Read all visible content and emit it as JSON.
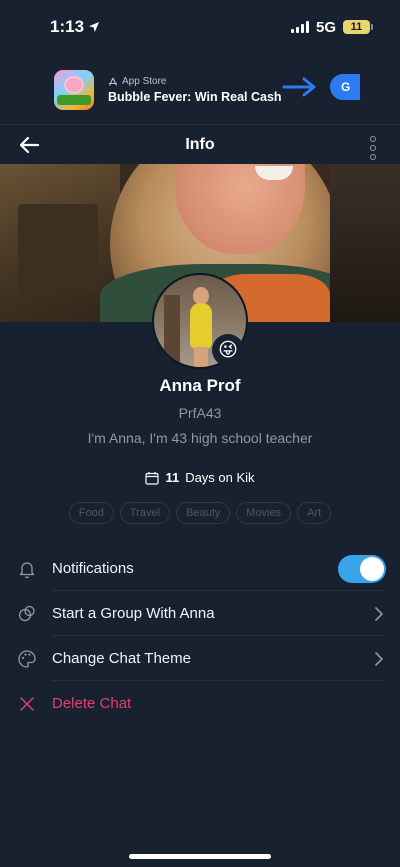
{
  "status_bar": {
    "time": "1:13",
    "network": "5G",
    "battery": "11"
  },
  "ad": {
    "source": "App Store",
    "title": "Bubble Fever: Win Real Cash",
    "button": "G",
    "arrow_color": "#2a7cf0"
  },
  "header": {
    "title": "Info"
  },
  "profile": {
    "name": "Anna Prof",
    "username": "PrfA43",
    "bio": "I'm Anna, I'm 43 high school teacher",
    "days_count": "11",
    "days_text": "Days on Kik",
    "emoji": "😜",
    "interests": [
      "Food",
      "Travel",
      "Beauty",
      "Movies",
      "Art"
    ]
  },
  "settings": {
    "notifications": {
      "label": "Notifications",
      "enabled": true
    },
    "group": {
      "label": "Start a Group With Anna"
    },
    "theme": {
      "label": "Change Chat Theme"
    },
    "delete": {
      "label": "Delete Chat"
    }
  },
  "colors": {
    "background": "#172130",
    "accent": "#3aa4ea",
    "danger": "#e23f6b"
  }
}
